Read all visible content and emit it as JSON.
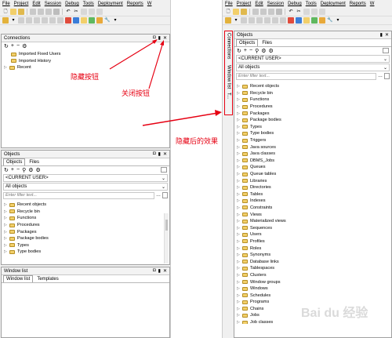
{
  "left": {
    "menu": [
      "File",
      "Project",
      "Edit",
      "Session",
      "Debug",
      "Tools",
      "Deployment",
      "Reports",
      "W"
    ],
    "connections": {
      "title": "Connections",
      "items": [
        {
          "label": "Imported Fixed Users"
        },
        {
          "label": "Imported History"
        },
        {
          "label": "Recent"
        }
      ]
    },
    "objects": {
      "title": "Objects",
      "tabs": [
        "Objects",
        "Files"
      ],
      "user_combo": "<CURRENT USER>",
      "type_combo": "All objects",
      "filter_placeholder": "Enter filter text...",
      "items": [
        "Recent objects",
        "Recycle bin",
        "Functions",
        "Procedures",
        "Packages",
        "Package bodies",
        "Types",
        "Type bodies"
      ]
    },
    "window_list": {
      "title": "Window list",
      "tabs": [
        "Window list",
        "Templates"
      ]
    }
  },
  "right": {
    "menu": [
      "File",
      "Project",
      "Edit",
      "Session",
      "Debug",
      "Tools",
      "Deployment",
      "Reports",
      "W"
    ],
    "side_tabs": [
      "Connections",
      "Window list",
      "T..."
    ],
    "objects": {
      "title": "Objects",
      "tabs": [
        "Objects",
        "Files"
      ],
      "user_combo": "<CURRENT USER>",
      "type_combo": "All objects",
      "filter_placeholder": "Enter filter text...",
      "items": [
        "Recent objects",
        "Recycle bin",
        "Functions",
        "Procedures",
        "Packages",
        "Package bodies",
        "Types",
        "Type bodies",
        "Triggers",
        "Java sources",
        "Java classes",
        "DBMS_Jobs",
        "Queues",
        "Queue tables",
        "Libraries",
        "Directories",
        "Tables",
        "Indexes",
        "Constraints",
        "Views",
        "Materialized views",
        "Sequences",
        "Users",
        "Profiles",
        "Roles",
        "Synonyms",
        "Database links",
        "Tablespaces",
        "Clusters",
        "Window groups",
        "Windows",
        "Schedules",
        "Programs",
        "Chains",
        "Jobs",
        "Job classes"
      ]
    }
  },
  "annotations": {
    "hide_button": "隐藏按钮",
    "close_button": "关闭按钮",
    "after_hide": "隐藏后的效果"
  },
  "watermark": "Bai du 经验",
  "colors": {
    "annotation_red": "#e60012",
    "folder_yellow": "#f2cf6a"
  }
}
